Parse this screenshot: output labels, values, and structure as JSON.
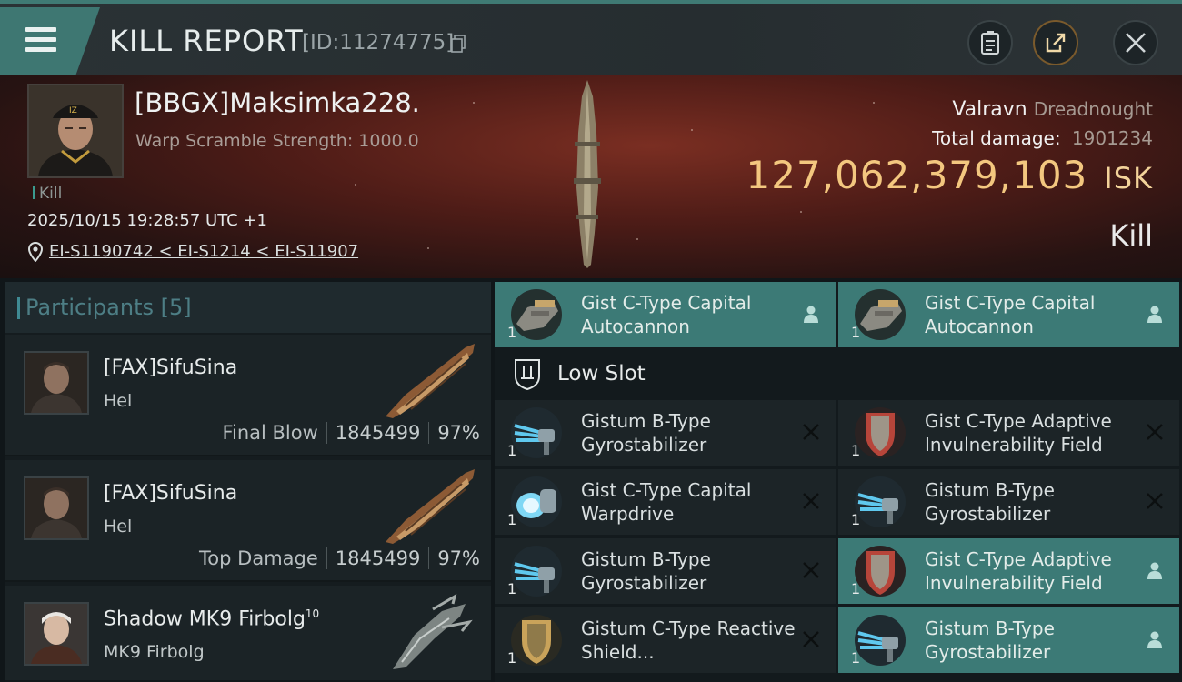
{
  "header": {
    "title": "KILL REPORT",
    "id_text": "[ID:11274775]"
  },
  "victim": {
    "name": "[BBGX]Maksimka228.",
    "stat": "Warp Scramble Strength: 1000.0",
    "event_type": "Kill",
    "datetime": "2025/10/15 19:28:57 UTC +1",
    "location": "EI-S1190742 < EI-S1214 < EI-S11907",
    "ship_name": "Valravn",
    "ship_class": "Dreadnought",
    "total_damage_label": "Total damage:",
    "total_damage": "1901234",
    "isk_value": "127,062,379,103",
    "isk_unit": "ISK",
    "result": "Kill"
  },
  "participants": {
    "label": "Participants",
    "count": "[5]",
    "rows": [
      {
        "name": "[FAX]SifuSina",
        "ship": "Hel",
        "role": "Final Blow",
        "damage": "1845499",
        "percent": "97%"
      },
      {
        "name": "[FAX]SifuSina",
        "ship": "Hel",
        "role": "Top Damage",
        "damage": "1845499",
        "percent": "97%"
      },
      {
        "name": "Shadow MK9 Firbolg",
        "level": "10",
        "ship": "MK9 Firbolg"
      }
    ]
  },
  "fitting": {
    "top_modules": [
      {
        "name": "Gist C-Type Capital Autocannon",
        "qty": "1"
      },
      {
        "name": "Gist C-Type Capital Autocannon",
        "qty": "1"
      }
    ],
    "low_slot_label": "Low Slot",
    "low_modules": [
      {
        "name": "Gistum B-Type Gyrostabilizer",
        "qty": "1"
      },
      {
        "name": "Gist C-Type Adaptive Invulnerability Field",
        "qty": "1"
      },
      {
        "name": "Gist C-Type Capital Warpdrive",
        "qty": "1"
      },
      {
        "name": "Gistum B-Type Gyrostabilizer",
        "qty": "1"
      },
      {
        "name": "Gistum B-Type Gyrostabilizer",
        "qty": "1"
      },
      {
        "name": "Gist C-Type Adaptive Invulnerability Field",
        "qty": "1"
      },
      {
        "name": "Gistum C-Type Reactive Shield...",
        "qty": "1"
      },
      {
        "name": "Gistum B-Type Gyrostabilizer",
        "qty": "1"
      }
    ]
  },
  "colors": {
    "accent": "#3c7a76",
    "isk": "#f3c77f",
    "banner": "#4e1c17"
  }
}
